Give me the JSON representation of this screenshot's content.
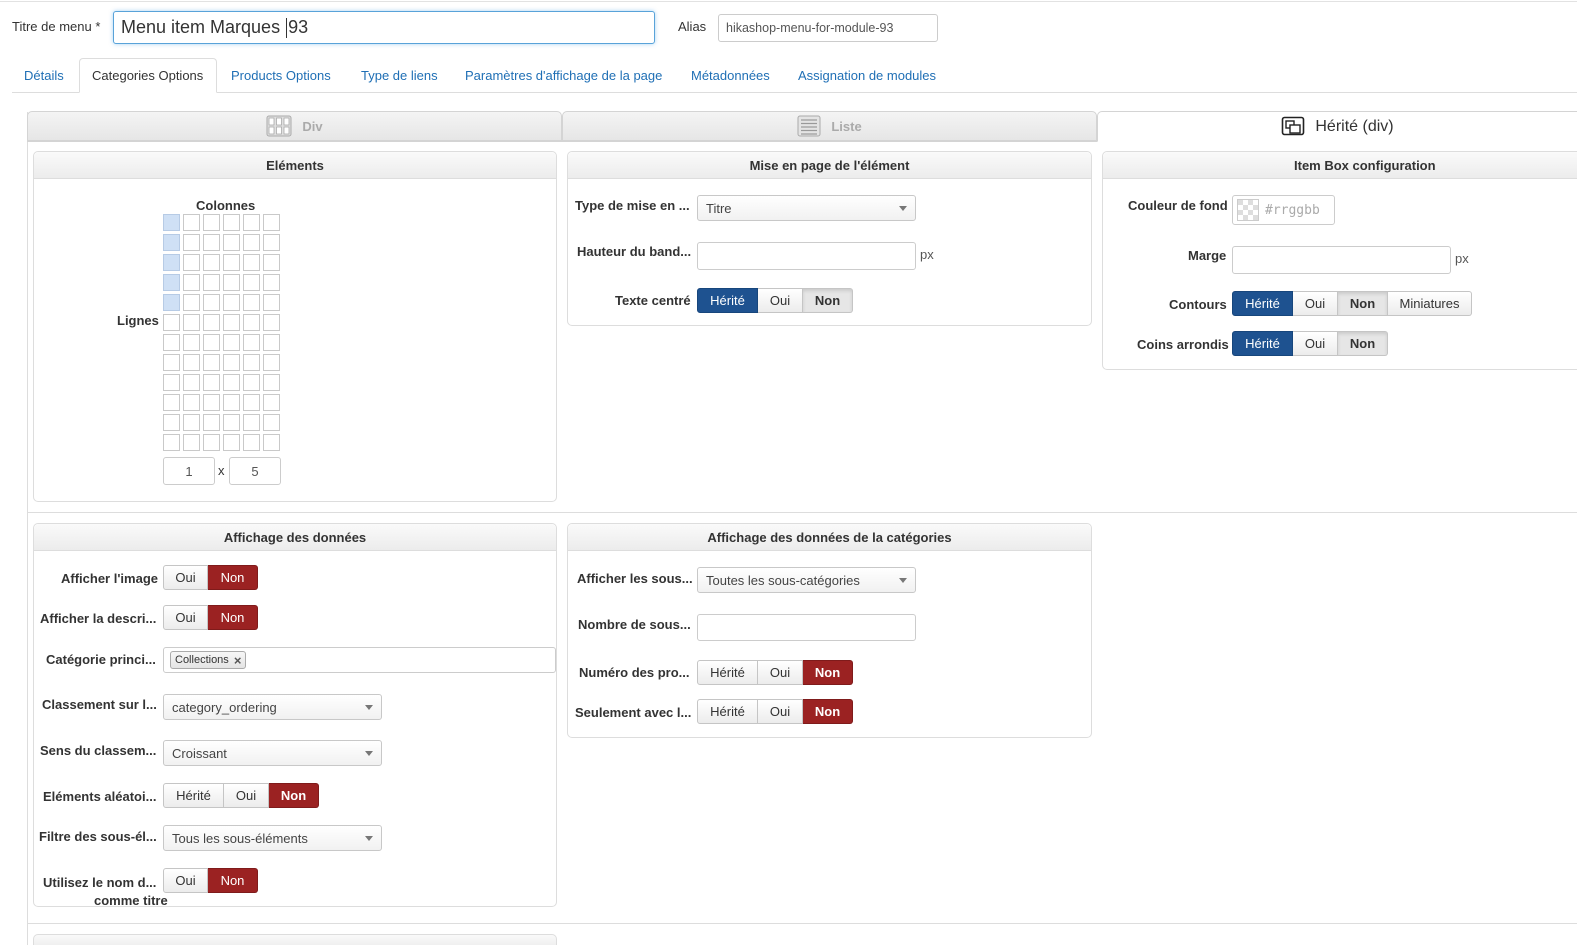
{
  "header": {
    "menu_title_label": "Titre de menu *",
    "menu_title_before_caret": "Menu item Marques ",
    "menu_title_after_caret": "93",
    "alias_label": "Alias",
    "alias_value": "hikashop-menu-for-module-93"
  },
  "tabs": [
    {
      "label": "Détails"
    },
    {
      "label": "Categories Options"
    },
    {
      "label": "Products Options"
    },
    {
      "label": "Type de liens"
    },
    {
      "label": "Paramètres d'affichage de la page"
    },
    {
      "label": "Métadonnées"
    },
    {
      "label": "Assignation de modules"
    }
  ],
  "active_tab": "Categories Options",
  "layout_tabs": [
    {
      "label": "Div",
      "icon": "grid-layout-icon"
    },
    {
      "label": "Liste",
      "icon": "list-layout-icon"
    },
    {
      "label": "Hérité (div)",
      "icon": "inherit-layout-icon"
    }
  ],
  "elements_panel": {
    "title": "Eléments",
    "columns_label": "Colonnes",
    "rows_label": "Lignes",
    "grid_columns": 6,
    "grid_rows": 12,
    "highlight_rows": 5,
    "highlight_cols": 1,
    "cols_value": "1",
    "times": "x",
    "rows_value": "5"
  },
  "layout_panel": {
    "title": "Mise en page de l'élément",
    "type_label": "Type de mise en ...",
    "type_value": "Titre",
    "height_label": "Hauteur du band...",
    "height_unit": "px",
    "centered_label": "Texte centré",
    "centered_options": [
      "Hérité",
      "Oui",
      "Non"
    ]
  },
  "itembox_panel": {
    "title": "Item Box configuration",
    "bg_label": "Couleur de fond",
    "bg_placeholder": "#rrggbb",
    "margin_label": "Marge",
    "margin_unit": "px",
    "border_label": "Contours",
    "border_options": [
      "Hérité",
      "Oui",
      "Non",
      "Miniatures"
    ],
    "rounded_label": "Coins arrondis",
    "rounded_options": [
      "Hérité",
      "Oui",
      "Non"
    ]
  },
  "data_panel": {
    "title": "Affichage des données",
    "show_image_label": "Afficher l'image",
    "show_desc_label": "Afficher la descri...",
    "main_cat_label": "Catégorie princi...",
    "main_cat_tag": "Collections",
    "ordering_label": "Classement sur l...",
    "ordering_value": "category_ordering",
    "direction_label": "Sens du classem...",
    "direction_value": "Croissant",
    "random_label": "Eléments aléatoi...",
    "filter_label": "Filtre des sous-él...",
    "filter_value": "Tous les sous-éléments",
    "use_name_label_1": "Utilisez le nom d...",
    "use_name_label_2": "comme titre",
    "yes": "Oui",
    "no": "Non",
    "inherit": "Hérité"
  },
  "cat_data_panel": {
    "title": "Affichage des données de la catégories",
    "show_sub_label": "Afficher les sous...",
    "show_sub_value": "Toutes les sous-catégories",
    "nb_sub_label": "Nombre de sous...",
    "num_products_label": "Numéro des pro...",
    "only_with_label": "Seulement avec l...",
    "inherit": "Hérité",
    "yes": "Oui",
    "no": "Non"
  },
  "colors": {
    "link": "#1f6fb5",
    "inherit_blue": "#1e5290",
    "no_red": "#9b2222"
  }
}
